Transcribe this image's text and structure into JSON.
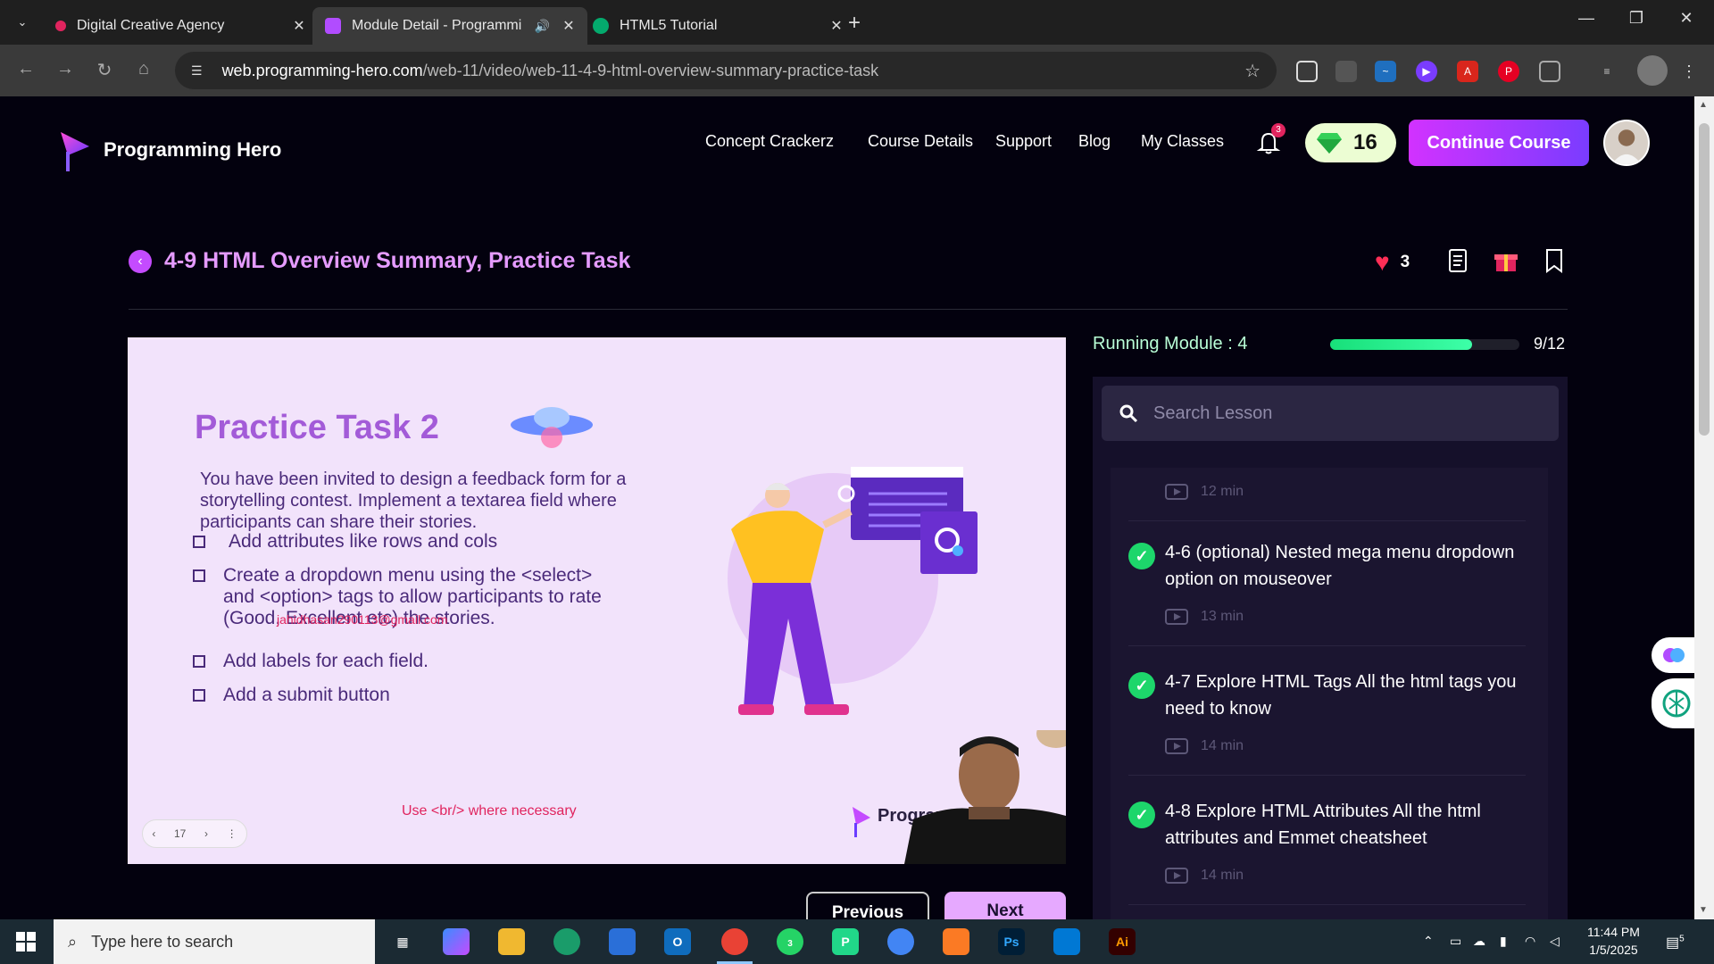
{
  "browser": {
    "tabs": [
      {
        "title": "Digital Creative Agency",
        "active": false,
        "favicon_color": "#e0245e"
      },
      {
        "title": "Module Detail - Programmi",
        "active": true,
        "favicon_color": "#b14cff"
      },
      {
        "title": "HTML5 Tutorial",
        "active": false,
        "favicon_color": "#04aa6d"
      }
    ],
    "url_host": "web.programming-hero.com",
    "url_path": "/web-11/video/web-11-4-9-html-overview-summary-practice-task"
  },
  "site": {
    "brand": "Programming Hero",
    "nav": [
      "Concept Crackerz",
      "Course Details",
      "Support",
      "Blog",
      "My Classes"
    ],
    "notification_count": "3",
    "gems": "16",
    "continue_label": "Continue Course"
  },
  "lesson": {
    "title": "4-9 HTML Overview Summary, Practice Task",
    "likes": "3"
  },
  "slide": {
    "title": "Practice Task 2",
    "intro": "You have been invited to design a feedback form for a storytelling contest. Implement a textarea field where participants can share their stories.",
    "tasks": [
      "Add attributes like rows and cols",
      "Create a dropdown menu using the <select> and <option> tags to allow participants to rate (Good, Excellent etc) the stories.",
      "Add labels for each field.",
      "Add a submit button"
    ],
    "watermark": "jahidhasan290113@gmail.com",
    "note": "Use <br/> where necessary",
    "page_number": "17",
    "brand_text": "Programm"
  },
  "controls": {
    "previous_label": "Previous",
    "next_label": "Next"
  },
  "sidebar": {
    "running_module": "Running Module : 4",
    "progress_text": "9/12",
    "progress_fraction": 0.75,
    "search_placeholder": "Search Lesson",
    "items": [
      {
        "title": "",
        "duration": "12 min"
      },
      {
        "title": "4-6 (optional) Nested mega menu dropdown option on mouseover",
        "duration": "13 min"
      },
      {
        "title": "4-7 Explore HTML Tags All the html tags you need to know",
        "duration": "14 min"
      },
      {
        "title": "4-8 Explore HTML Attributes All the html attributes and Emmet cheatsheet",
        "duration": "14 min"
      }
    ]
  },
  "taskbar": {
    "search_placeholder": "Type here to search",
    "time": "11:44 PM",
    "date": "1/5/2025",
    "whatsapp_badge": "3",
    "notification_badge": "5"
  },
  "colors": {
    "accent": "#c44bff",
    "title_pink": "#e59bff",
    "progress_green": "#18e07a",
    "page_bg": "#03010e"
  }
}
